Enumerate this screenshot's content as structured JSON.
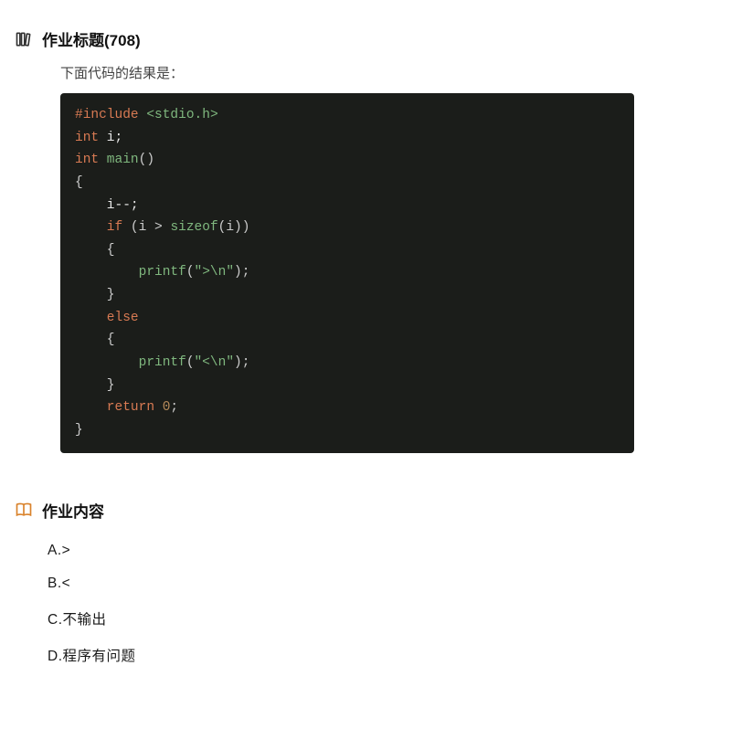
{
  "title_section": {
    "heading": "作业标题(708)",
    "description": "下面代码的结果是："
  },
  "code": {
    "line1_pre": "#include",
    "line1_hdr": " <stdio.h>",
    "line2_kw": "int",
    "line2_id": " i;",
    "line3_kw": "int",
    "line3_fn": " main",
    "line3_pn": "()",
    "line4": "{",
    "line5_id": "    i--;",
    "line6_kw": "    if",
    "line6_rest_a": " (i > ",
    "line6_fn": "sizeof",
    "line6_rest_b": "(i))",
    "line7": "    {",
    "line8_fn": "        printf",
    "line8_pn_a": "(",
    "line8_str": "\">\\n\"",
    "line8_pn_b": ");",
    "line9": "    }",
    "line10_kw": "    else",
    "line11": "    {",
    "line12_fn": "        printf",
    "line12_pn_a": "(",
    "line12_str": "\"<\\n\"",
    "line12_pn_b": ");",
    "line13": "    }",
    "line14_kw": "    return",
    "line14_num": " 0",
    "line14_pn": ";",
    "line15": "}"
  },
  "content_section": {
    "heading": "作业内容"
  },
  "options": [
    {
      "label": "A.>"
    },
    {
      "label": "B.<"
    },
    {
      "label": "C.不输出"
    },
    {
      "label": "D.程序有问题"
    }
  ]
}
